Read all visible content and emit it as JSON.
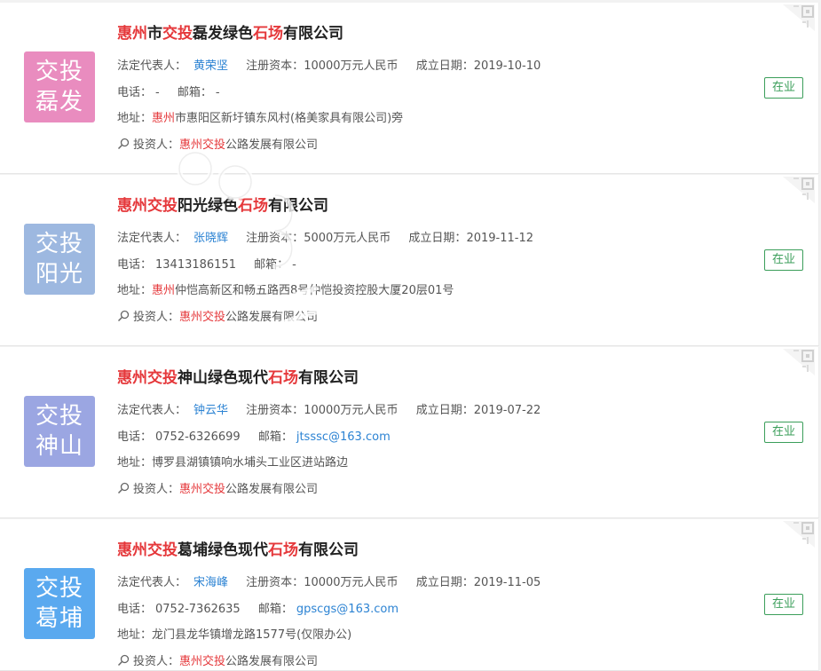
{
  "labels": {
    "legal_rep": "法定代表人：",
    "capital": "注册资本：",
    "date": "成立日期：",
    "phone": "电话：",
    "email": "邮箱：",
    "address": "地址：",
    "investor": "投资人："
  },
  "companies": [
    {
      "name_parts": [
        "惠州",
        "市",
        "交投",
        "磊发绿色",
        "石场",
        "有限公司"
      ],
      "logo": [
        "交投",
        "磊发"
      ],
      "logo_color": "#e98cbf",
      "legal_rep": "黄荣坚",
      "capital": "10000万元人民币",
      "date": "2019-10-10",
      "phone": "-",
      "email": "-",
      "address_hl": "惠州",
      "address_rest": "市惠阳区新圩镇东风村(格美家具有限公司)旁",
      "investor_hl": "惠州交投",
      "investor_rest": "公路发展有限公司",
      "status": "在业"
    },
    {
      "name_parts": [
        "惠州",
        "",
        "交投",
        "阳光绿色",
        "石场",
        "有限公司"
      ],
      "logo": [
        "交投",
        "阳光"
      ],
      "logo_color": "#9db8e0",
      "legal_rep": "张晓辉",
      "capital": "5000万元人民币",
      "date": "2019-11-12",
      "phone": "13413186151",
      "email": "-",
      "address_hl": "惠州",
      "address_rest": "仲恺高新区和畅五路西8号仲恺投资控股大厦20层01号",
      "investor_hl": "惠州交投",
      "investor_rest": "公路发展有限公司",
      "status": "在业"
    },
    {
      "name_parts": [
        "惠州",
        "",
        "交投",
        "神山绿色现代",
        "石场",
        "有限公司"
      ],
      "logo": [
        "交投",
        "神山"
      ],
      "logo_color": "#9ba6e2",
      "legal_rep": "钟云华",
      "capital": "10000万元人民币",
      "date": "2019-07-22",
      "phone": "0752-6326699",
      "email": "jtsssc@163.com",
      "address_hl": "",
      "address_rest": "博罗县湖镇镇响水埔头工业区进站路边",
      "investor_hl": "惠州交投",
      "investor_rest": "公路发展有限公司",
      "status": "在业"
    },
    {
      "name_parts": [
        "惠州",
        "",
        "交投",
        "葛埔绿色现代",
        "石场",
        "有限公司"
      ],
      "logo": [
        "交投",
        "葛埔"
      ],
      "logo_color": "#5aa9ef",
      "legal_rep": "宋海峰",
      "capital": "10000万元人民币",
      "date": "2019-11-05",
      "phone": "0752-7362635",
      "email": "gpscgs@163.com",
      "address_hl": "",
      "address_rest": "龙门县龙华镇增龙路1577号(仅限办公)",
      "investor_hl": "惠州交投",
      "investor_rest": "公路发展有限公司",
      "status": "在业"
    }
  ],
  "icons": {
    "search": "search-icon",
    "corner": "qr-corner-icon"
  }
}
